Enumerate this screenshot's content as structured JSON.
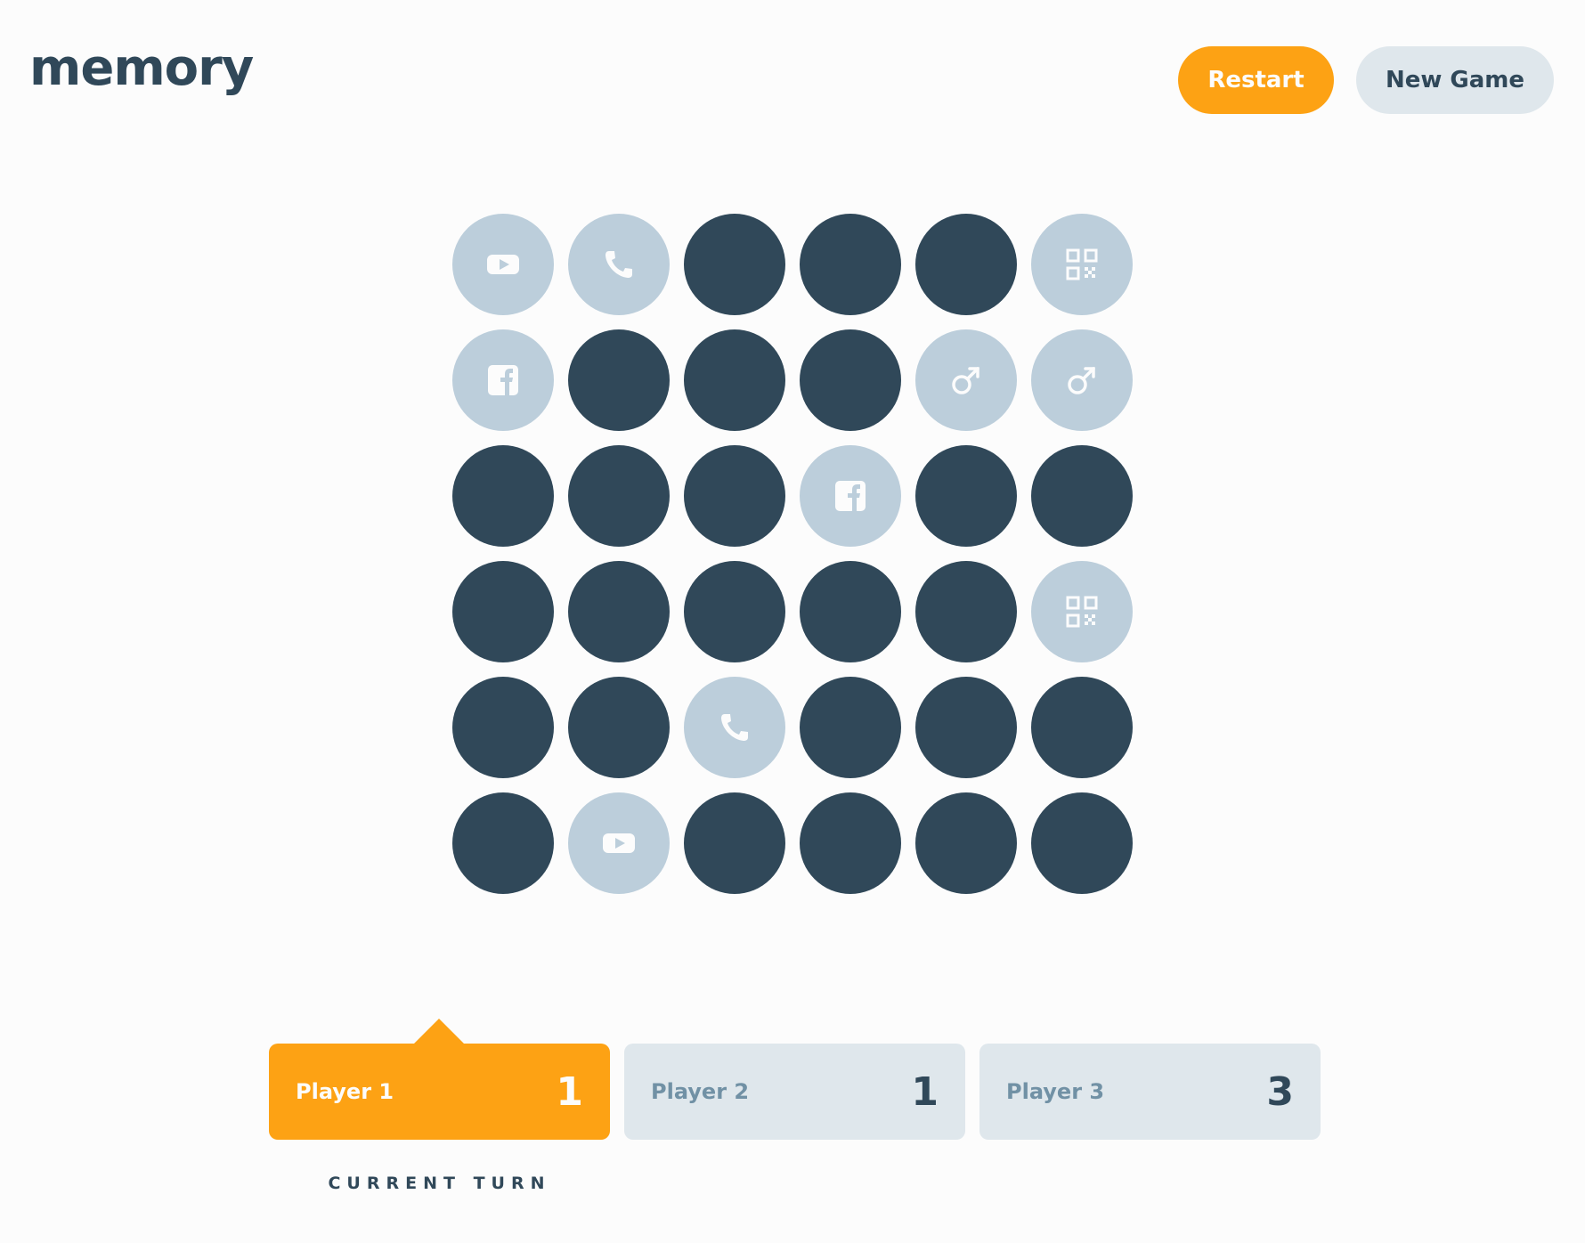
{
  "header": {
    "logo": "memory",
    "restart_label": "Restart",
    "new_game_label": "New Game"
  },
  "colors": {
    "accent": "#fda214",
    "hidden_tile": "#304859",
    "revealed_tile": "#bccedb",
    "inactive_card": "#dfe7ec"
  },
  "board": {
    "rows": 6,
    "cols": 6,
    "tiles": [
      "youtube-icon",
      "phone-icon",
      null,
      null,
      null,
      "qrcode-icon",
      "facebook-icon",
      null,
      null,
      null,
      "mars-icon",
      "mars-icon",
      null,
      null,
      null,
      "facebook-icon",
      null,
      null,
      null,
      null,
      null,
      null,
      null,
      "qrcode-icon",
      null,
      null,
      "phone-icon",
      null,
      null,
      null,
      null,
      "youtube-icon",
      null,
      null,
      null,
      null
    ]
  },
  "players": [
    {
      "name": "Player 1",
      "score": "1",
      "active": true
    },
    {
      "name": "Player 2",
      "score": "1",
      "active": false
    },
    {
      "name": "Player 3",
      "score": "3",
      "active": false
    }
  ],
  "current_turn_label": "CURRENT TURN"
}
